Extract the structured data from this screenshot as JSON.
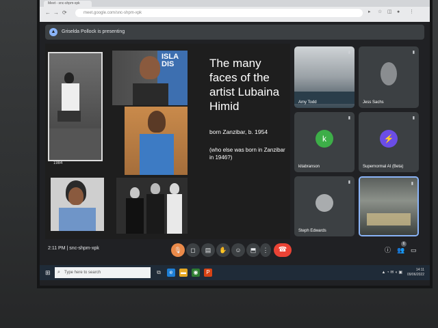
{
  "browser": {
    "tab_title": "Meet - snc-shpm-xpk",
    "url": "meet.google.com/snc-shpm-xpk",
    "back_glyph": "←",
    "forward_glyph": "→",
    "reload_glyph": "⟳"
  },
  "presenter": {
    "text": "Griselda Pollock is presenting",
    "icon": "present-icon"
  },
  "slide": {
    "title": "The many faces of the artist Lubaina Himid",
    "subtitle": "born Zanzibar, b. 1954",
    "question": "(who else was born in Zanzibar in 1946?)",
    "photo_caption": "1984",
    "poster_text": "ISLA DIS"
  },
  "participants": [
    {
      "name": "Amy Todd",
      "kind": "video"
    },
    {
      "name": "Jess Sachs",
      "kind": "photo"
    },
    {
      "name": "kitabranson",
      "kind": "initial",
      "initial": "k",
      "color": "#3dae48"
    },
    {
      "name": "Supernormal AI (Beta)",
      "kind": "logo",
      "color": "#6b4de6"
    },
    {
      "name": "Steph Edwards",
      "kind": "photo"
    },
    {
      "name": "",
      "kind": "self-video"
    }
  ],
  "callbar": {
    "time": "2:11 PM",
    "separator": "|",
    "meeting_code": "snc-shpm-xpk",
    "controls": [
      "mic-icon",
      "camera-icon",
      "captions-icon",
      "raise-hand-icon",
      "emoji-icon",
      "present-icon",
      "more-icon"
    ],
    "hangup_glyph": "☎",
    "badge_count": "6"
  },
  "taskbar": {
    "search_placeholder": "Type here to search",
    "time": "14:11",
    "date": "09/06/2022"
  },
  "colors": {
    "meet_bg": "#202124",
    "tile_bg": "#3c4043",
    "hangup": "#ea4335",
    "accent": "#8ab4f8"
  }
}
